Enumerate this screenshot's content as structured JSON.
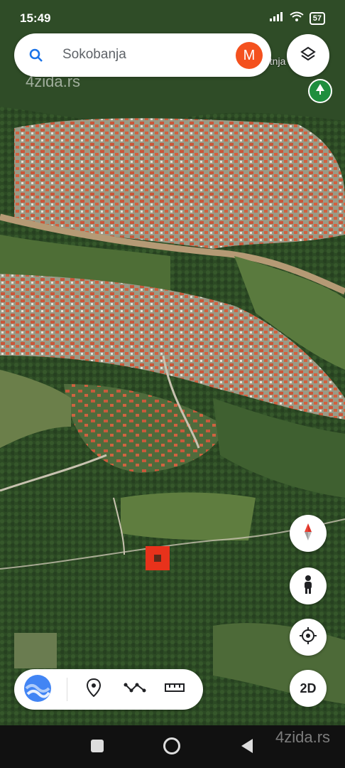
{
  "status_bar": {
    "time": "15:49",
    "battery": "57"
  },
  "search": {
    "text": "Sokobanja",
    "avatar_letter": "M"
  },
  "map": {
    "place_label": "etnja  nica"
  },
  "watermarks": {
    "top": "4zida.rs",
    "bottom": "4zida.rs"
  },
  "controls": {
    "view_mode": "2D"
  },
  "icons": {
    "search": "search-icon",
    "layers": "layers-icon",
    "park_pin": "tree-pin-icon",
    "compass": "compass-icon",
    "street_view": "pegman-icon",
    "my_location": "crosshair-icon",
    "voyager": "wave-logo-icon",
    "place": "map-pin-icon",
    "path": "path-icon",
    "measure": "ruler-icon"
  },
  "colors": {
    "accent_red": "#e8321b",
    "avatar": "#f4511e"
  }
}
